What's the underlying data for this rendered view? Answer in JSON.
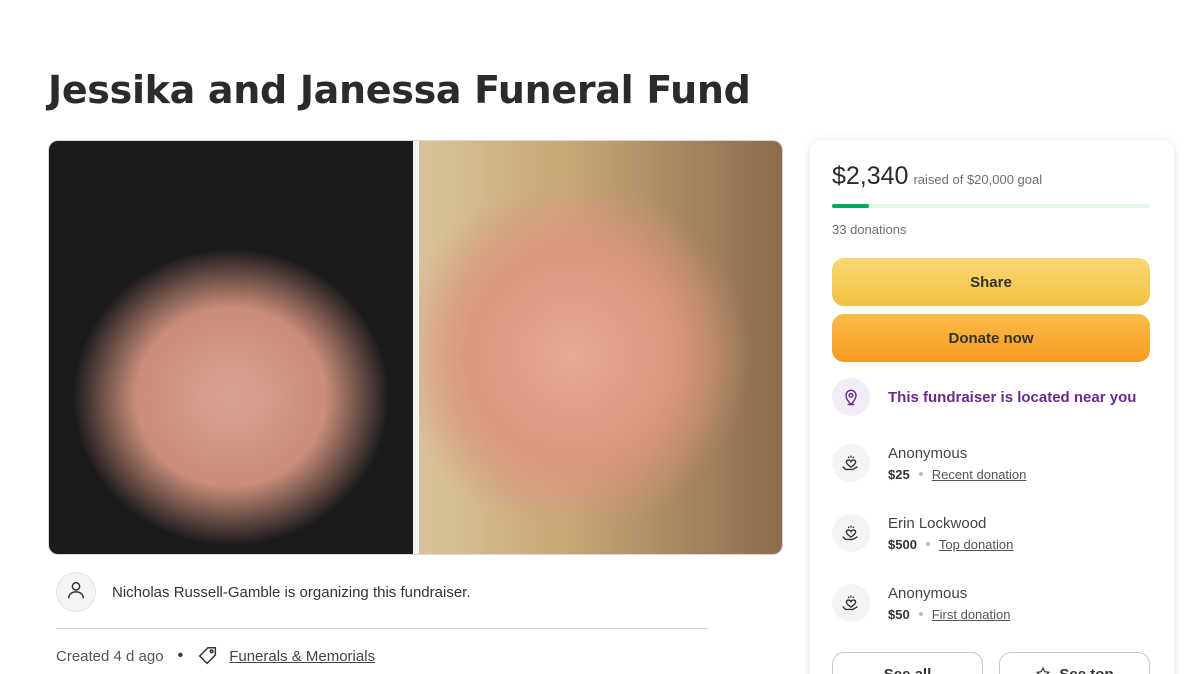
{
  "page": {
    "title": "Jessika and Janessa Funeral Fund"
  },
  "organizer": {
    "text": "Nicholas Russell-Gamble is organizing this fundraiser."
  },
  "meta": {
    "created": "Created 4 d ago",
    "separator": "•",
    "category": "Funerals & Memorials"
  },
  "card": {
    "raised_amount": "$2,340",
    "raised_goal": "raised of $20,000 goal",
    "progress_fraction": 0.117,
    "donations_count": "33 donations",
    "share_label": "Share",
    "donate_label": "Donate now",
    "nearby_text": "This fundraiser is located near you",
    "donors": [
      {
        "name": "Anonymous",
        "amount": "$25",
        "tag": "Recent donation"
      },
      {
        "name": "Erin Lockwood",
        "amount": "$500",
        "tag": "Top donation"
      },
      {
        "name": "Anonymous",
        "amount": "$50",
        "tag": "First donation"
      }
    ],
    "see_all_label": "See all",
    "see_top_label": "See top"
  },
  "colors": {
    "progress": "#02a95c",
    "share_button": "#f3c042",
    "donate_button": "#f79a1f",
    "nearby_text": "#6b2b8c"
  },
  "icons": {
    "organizer": "user-icon",
    "category": "tag-icon",
    "nearby": "location-pin-icon",
    "donor": "heart-hand-icon",
    "see_top": "star-icon"
  }
}
